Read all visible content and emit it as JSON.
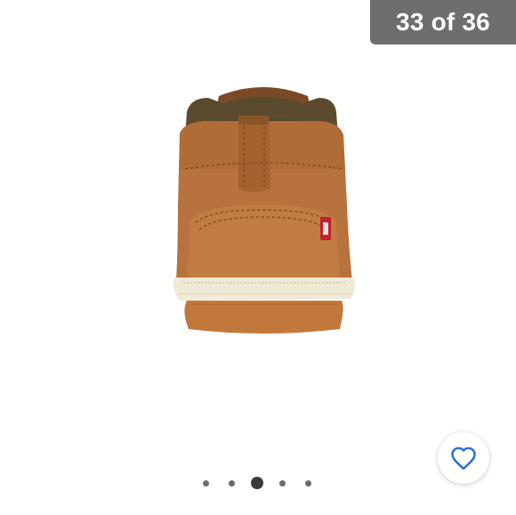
{
  "gallery": {
    "counter_text": "33 of 36",
    "current_index": 33,
    "total": 36,
    "dots_visible": 5,
    "active_dot": 3
  },
  "product_image": {
    "brand_tab_text": "Levi's"
  },
  "favorite": {
    "icon": "heart-outline-icon",
    "color": "#2a6fdb"
  },
  "colors": {
    "counter_bg": "#6e6e6e",
    "dot": "#6b6b6b",
    "dot_active": "#3a3a3a"
  }
}
